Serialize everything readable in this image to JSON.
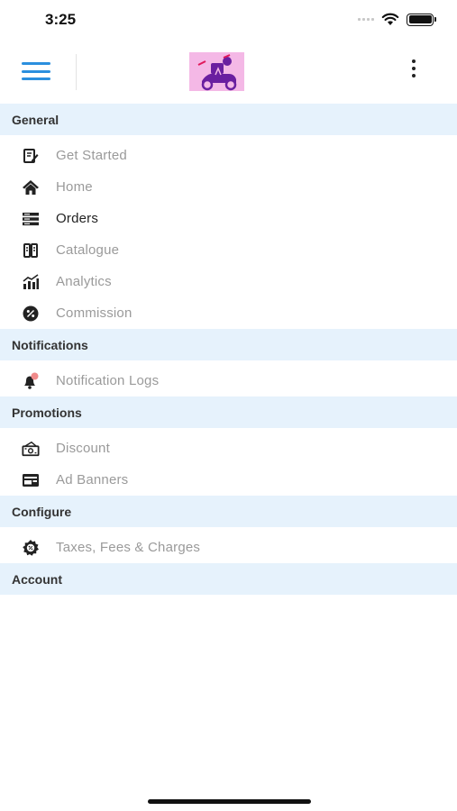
{
  "status_bar": {
    "time": "3:25"
  },
  "header": {
    "menu_icon": "hamburger-icon",
    "logo_icon": "delivery-scooter-logo",
    "more_icon": "more-vertical-icon"
  },
  "sections": {
    "general": {
      "title": "General",
      "items": [
        {
          "label": "Get Started",
          "icon": "get-started-icon"
        },
        {
          "label": "Home",
          "icon": "home-icon"
        },
        {
          "label": "Orders",
          "icon": "orders-icon"
        },
        {
          "label": "Catalogue",
          "icon": "catalogue-icon"
        },
        {
          "label": "Analytics",
          "icon": "analytics-icon"
        },
        {
          "label": "Commission",
          "icon": "commission-icon"
        }
      ]
    },
    "notifications": {
      "title": "Notifications",
      "items": [
        {
          "label": "Notification Logs",
          "icon": "notification-bell-icon"
        }
      ]
    },
    "promotions": {
      "title": "Promotions",
      "items": [
        {
          "label": "Discount",
          "icon": "discount-icon"
        },
        {
          "label": "Ad Banners",
          "icon": "ad-banner-icon"
        }
      ]
    },
    "configure": {
      "title": "Configure",
      "items": [
        {
          "label": "Taxes, Fees & Charges",
          "icon": "taxes-gear-icon"
        }
      ]
    },
    "account": {
      "title": "Account"
    }
  },
  "colors": {
    "accent": "#2b8fde",
    "section_bg": "#e6f2fc",
    "inactive_text": "#9a9a9a",
    "active_text": "#222222",
    "logo_bg": "#f4b8e6",
    "logo_purple": "#6a1fa0"
  }
}
